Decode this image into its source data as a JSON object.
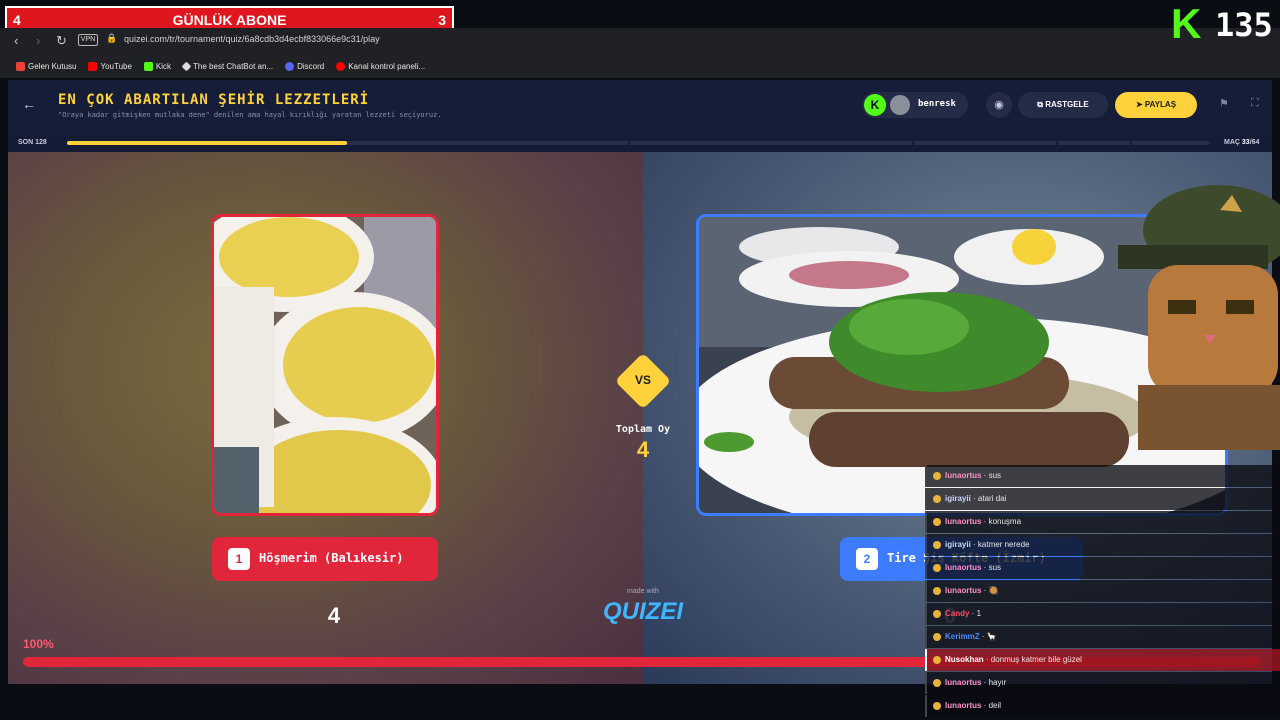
{
  "overlay": {
    "sub_left": "4",
    "sub_label": "GÜNLÜK ABONE",
    "sub_right": "3",
    "kick_count": "135"
  },
  "browser": {
    "vpn": "VPN",
    "url": "quizei.com/tr/tournament/quiz/6a8cdb3d4ecbf833066e9c31/play",
    "bookmarks": [
      {
        "label": "Gelen Kutusu",
        "color": "#ea4335"
      },
      {
        "label": "YouTube",
        "color": "#ff0000"
      },
      {
        "label": "Kick",
        "color": "#53fc18"
      },
      {
        "label": "The best ChatBot an...",
        "color": "#dddddd"
      },
      {
        "label": "Discord",
        "color": "#5865f2"
      },
      {
        "label": "Kanal kontrol paneli...",
        "color": "#ff0000"
      }
    ]
  },
  "header": {
    "title": "EN ÇOK ABARTILAN ŞEHİR LEZZETLERİ",
    "subtitle": "\"Oraya kadar gitmişken mutlaka dene\" denilen ama hayal kırıklığı yaratan lezzeti seçiyoruz.",
    "user": "benresk",
    "random_label": "RASTGELE",
    "share_label": "PAYLAŞ"
  },
  "progress": {
    "round_label": "SON 128",
    "match_label": "MAÇ",
    "match_current": "33",
    "match_total": "/64",
    "fraction": 0.245
  },
  "matchup": {
    "left": {
      "number": "1",
      "name": "Höşmerim (Balıkesir)",
      "votes": "4"
    },
    "right": {
      "number": "2",
      "name": "Tire Şiş Köfte (İzmir)",
      "votes": "0"
    },
    "vs_label": "VS",
    "total_label": "Toplam Oy",
    "total_value": "4",
    "made_with": "made with",
    "brand": "QUIZEI",
    "percent_label": "100%",
    "left_percent": 100
  },
  "chat": [
    {
      "user": "lunaortus",
      "text": "sus",
      "color": "#ff8fc8"
    },
    {
      "user": "igirayii",
      "text": "atari dai",
      "color": "#cbd5ff"
    },
    {
      "user": "lunaortus",
      "text": "konuşma",
      "color": "#ff8fc8"
    },
    {
      "user": "igirayii",
      "text": "katmer nerede",
      "color": "#cbd5ff"
    },
    {
      "user": "lunaortus",
      "text": "sus",
      "color": "#ff8fc8"
    },
    {
      "user": "lunaortus",
      "text": "🥘",
      "color": "#ff8fc8"
    },
    {
      "user": "Candy",
      "text": "1",
      "color": "#ff4b6b"
    },
    {
      "user": "KerimmZ",
      "text": "🦙",
      "color": "#4b8bff"
    },
    {
      "user": "Nusokhan",
      "text": "donmuş katmer bile güzel",
      "color": "#ffffff"
    },
    {
      "user": "lunaortus",
      "text": "hayır",
      "color": "#ff8fc8"
    },
    {
      "user": "lunaortus",
      "text": "deil",
      "color": "#ff8fc8"
    }
  ]
}
